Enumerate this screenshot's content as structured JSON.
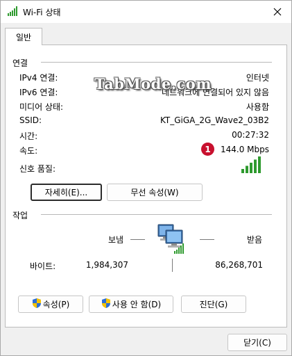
{
  "window": {
    "title": "Wi-Fi 상태"
  },
  "tabs": [
    {
      "label": "일반"
    }
  ],
  "connection": {
    "section_label": "연결",
    "rows": [
      {
        "label": "IPv4 연결:",
        "value": "인터넷"
      },
      {
        "label": "IPv6 연결:",
        "value": "네트워크에 연결되어 있지 않음"
      },
      {
        "label": "미디어 상태:",
        "value": "사용함"
      },
      {
        "label": "SSID:",
        "value": "KT_GiGA_2G_Wave2_03B2"
      },
      {
        "label": "시간:",
        "value": "00:27:32"
      },
      {
        "label": "속도:",
        "value": "144.0 Mbps"
      }
    ],
    "signal_label": "신호 품질:",
    "signal_bars": 5,
    "signal_max": 5
  },
  "buttons": {
    "details": "자세히(E)...",
    "wireless_props": "무선 속성(W)",
    "properties": "속성(P)",
    "disable": "사용 안 함(D)",
    "diagnose": "진단(G)",
    "close": "닫기(C)"
  },
  "activity": {
    "section_label": "작업",
    "sent_label": "보냄",
    "received_label": "받음",
    "bytes_label": "바이트:",
    "bytes_sent": "1,984,307",
    "bytes_received": "86,268,701"
  },
  "overlay": {
    "watermark": "TabMode.com",
    "badge": "1"
  },
  "colors": {
    "signal_green": "#2e9a2e",
    "badge_red": "#c8102e",
    "shield_blue": "#2d6fd6",
    "shield_yellow": "#f5c200"
  }
}
